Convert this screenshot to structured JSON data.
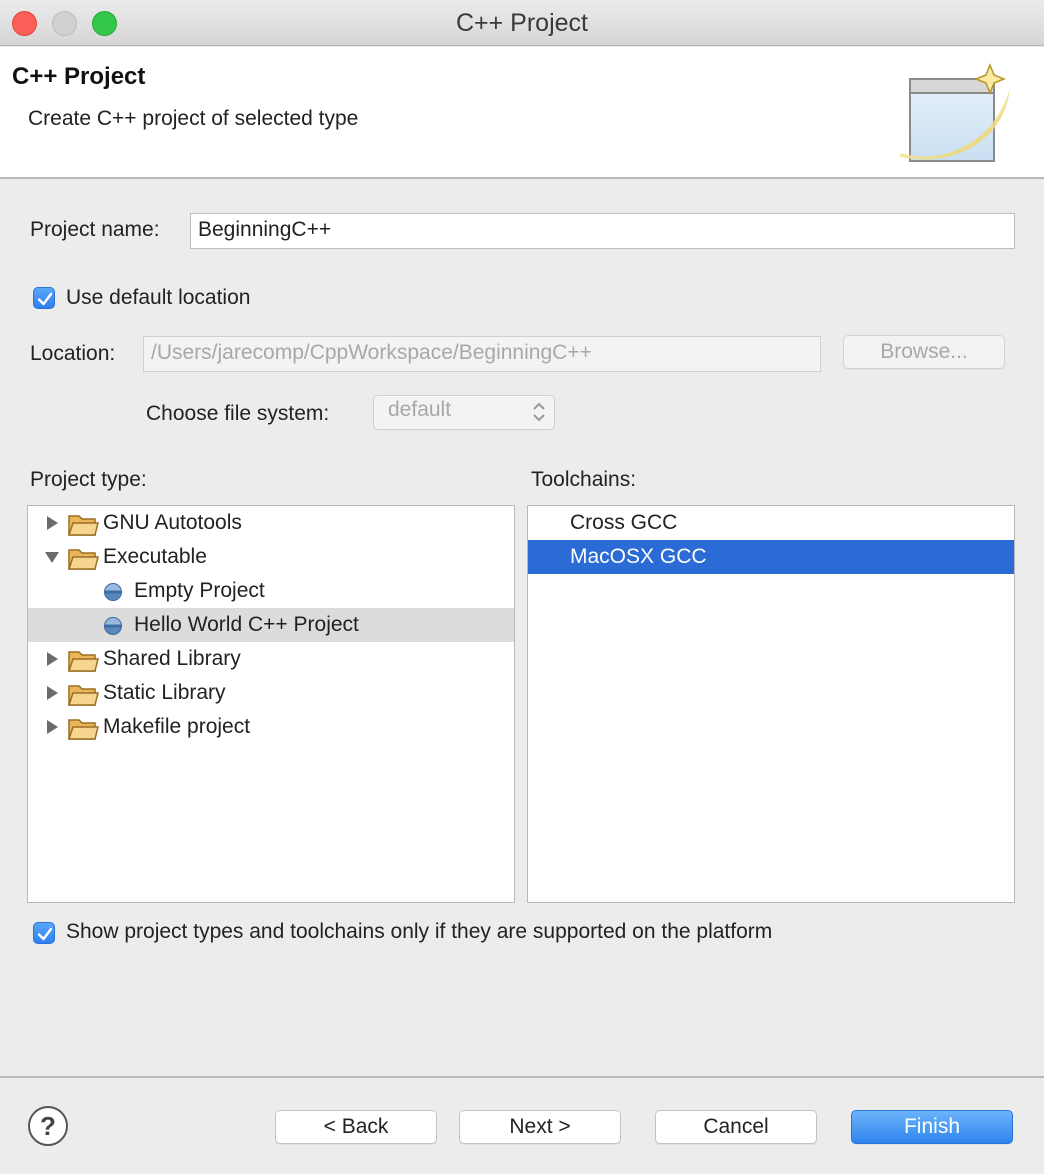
{
  "window": {
    "title": "C++ Project"
  },
  "header": {
    "title": "C++ Project",
    "subtitle": "Create C++ project of selected type",
    "icon": "new-project-wizard-icon"
  },
  "form": {
    "project_name_label": "Project name:",
    "project_name_value": "BeginningC++",
    "use_default_location_label": "Use default location",
    "use_default_location_checked": true,
    "location_label": "Location:",
    "location_value": "/Users/jarecomp/CppWorkspace/BeginningC++",
    "browse_label": "Browse...",
    "file_system_label": "Choose file system:",
    "file_system_value": "default"
  },
  "project_types": {
    "label": "Project type:",
    "items": [
      {
        "label": "GNU Autotools",
        "kind": "folder",
        "expanded": false
      },
      {
        "label": "Executable",
        "kind": "folder",
        "expanded": true
      },
      {
        "label": "Empty Project",
        "kind": "template"
      },
      {
        "label": "Hello World C++ Project",
        "kind": "template",
        "selected": true
      },
      {
        "label": "Shared Library",
        "kind": "folder",
        "expanded": false
      },
      {
        "label": "Static Library",
        "kind": "folder",
        "expanded": false
      },
      {
        "label": "Makefile project",
        "kind": "folder",
        "expanded": false
      }
    ]
  },
  "toolchains": {
    "label": "Toolchains:",
    "items": [
      {
        "label": "Cross GCC",
        "selected": false
      },
      {
        "label": "MacOSX GCC",
        "selected": true
      }
    ]
  },
  "filter": {
    "label": "Show project types and toolchains only if they are supported on the platform",
    "checked": true
  },
  "footer": {
    "help_symbol": "?",
    "back_label": "< Back",
    "next_label": "Next >",
    "cancel_label": "Cancel",
    "finish_label": "Finish"
  },
  "colors": {
    "selection_blue": "#2a6bd6",
    "selection_grey": "#dcdcdc",
    "accent": "#2f86ee"
  }
}
